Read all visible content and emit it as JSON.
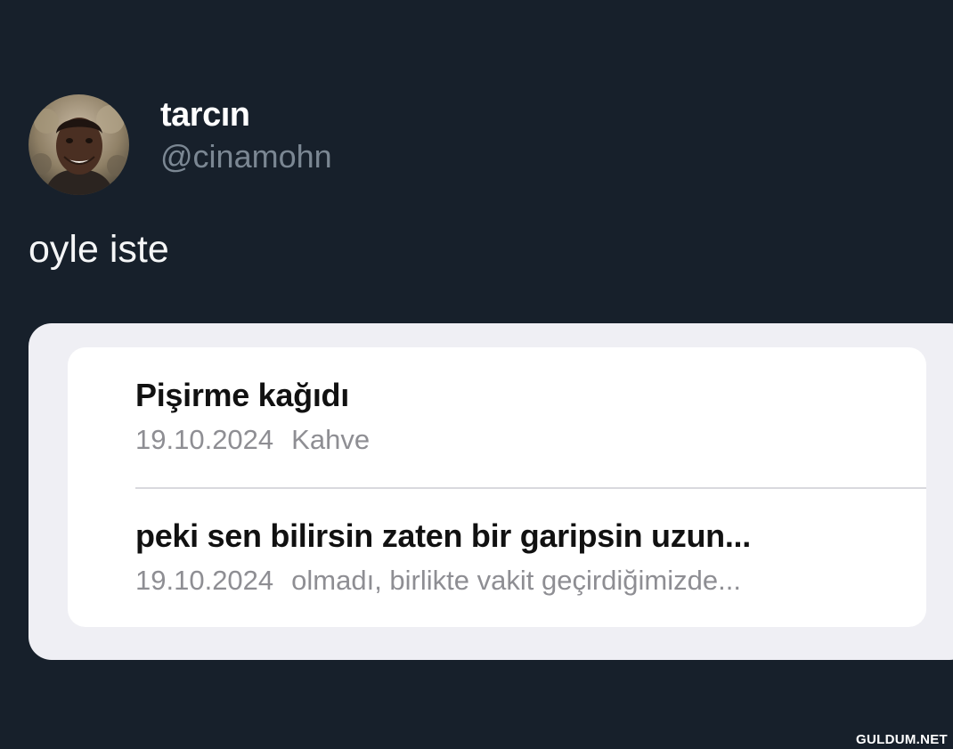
{
  "post": {
    "display_name": "tarcın",
    "handle": "@cinamohn",
    "text": "oyle iste"
  },
  "notes": [
    {
      "title": "Pişirme kağıdı",
      "date": "19.10.2024",
      "preview": "Kahve"
    },
    {
      "title": "peki sen bilirsin zaten bir garipsin uzun...",
      "date": "19.10.2024",
      "preview": "olmadı, birlikte vakit geçirdiğimizde..."
    }
  ],
  "watermark": "GULDUM.NET",
  "colors": {
    "background": "#17202b",
    "handle": "#7b8793",
    "card": "#efeff4",
    "list": "#ffffff",
    "note_meta": "#8e8e93"
  }
}
